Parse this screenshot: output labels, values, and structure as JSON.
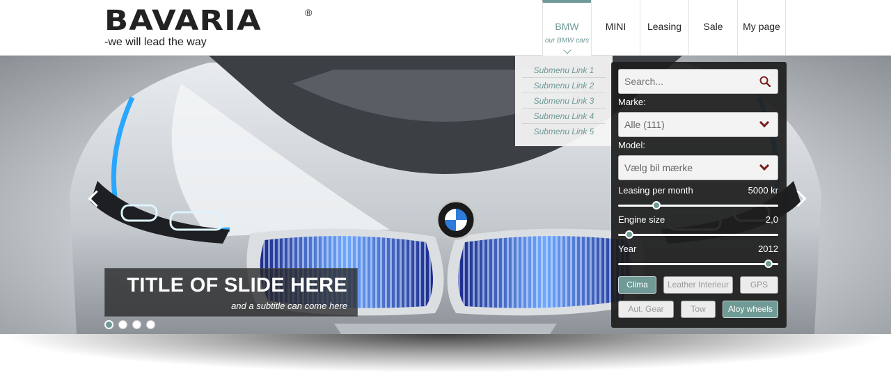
{
  "brand": {
    "logo_text": "BAVARIA",
    "registered": "®",
    "tagline": "-we will lead the way"
  },
  "nav": {
    "items": [
      {
        "label": "BMW",
        "sub": "our BMW cars"
      },
      {
        "label": "MINI"
      },
      {
        "label": "Leasing"
      },
      {
        "label": "Sale"
      },
      {
        "label": "My page"
      }
    ]
  },
  "submenu": [
    "Submenu Link 1",
    "Submenu Link 2",
    "Submenu Link 3",
    "Submenu Link 4",
    "Submenu Link 5"
  ],
  "slide": {
    "title": "TITLE OF SLIDE HERE",
    "subtitle": "and a subtitle can come here",
    "slide_count": 4,
    "active_slide": 1
  },
  "search": {
    "placeholder": "Search...",
    "marke_label": "Marke:",
    "marke_value": "Alle (111)",
    "model_label": "Model:",
    "model_value": "Vælg bil mærke",
    "leasing_label": "Leasing per month",
    "leasing_value": "5000 kr",
    "leasing_level": 0.24,
    "engine_label": "Engine size",
    "engine_value": "2,0",
    "engine_level": 0.07,
    "year_label": "Year",
    "year_value": "2012",
    "year_level": 0.94,
    "options": [
      {
        "label": "Clima",
        "selected": true
      },
      {
        "label": "Leather Interieur",
        "selected": false
      },
      {
        "label": "GPS",
        "selected": false
      },
      {
        "label": "Aut. Gear",
        "selected": false
      },
      {
        "label": "Tow",
        "selected": false
      },
      {
        "label": "Aloy wheels",
        "selected": true
      }
    ]
  },
  "colors": {
    "accent": "#6f9a96",
    "chevron": "#7a1c1c",
    "panel": "#1e1e1e"
  },
  "icons": {
    "search": "search-icon",
    "dropdown": "chevron-down-icon",
    "prev": "chevron-left-icon",
    "next": "chevron-right-icon"
  }
}
